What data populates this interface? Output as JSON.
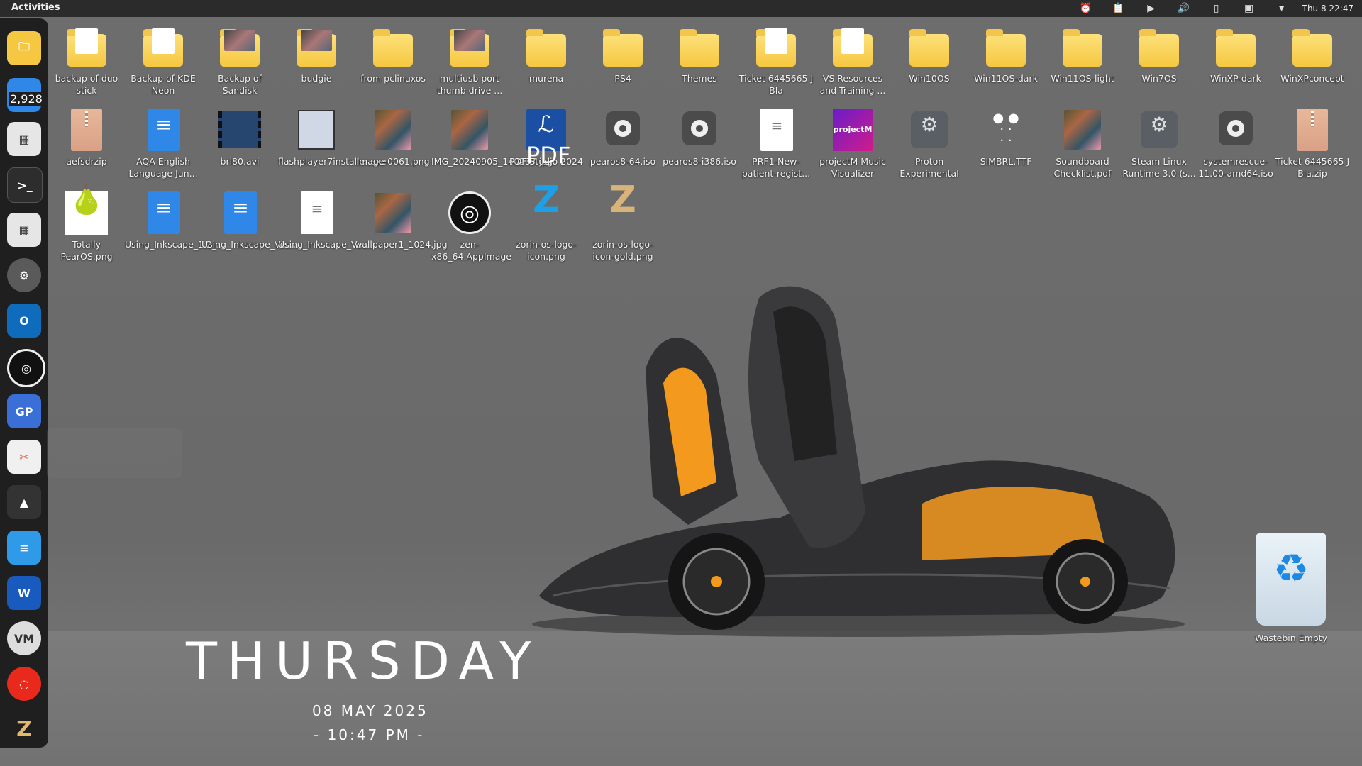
{
  "topbar": {
    "activities": "Activities",
    "clock": "Thu 8  22:47",
    "tray_icons": [
      "alarm-icon",
      "clipboard-icon",
      "play-icon",
      "volume-icon",
      "battery-icon",
      "window-icon",
      "chevron-down-icon"
    ]
  },
  "dock": {
    "mail_badge": "2,928",
    "items": [
      {
        "name": "files"
      },
      {
        "name": "mail"
      },
      {
        "name": "software"
      },
      {
        "name": "terminal"
      },
      {
        "name": "software-store"
      },
      {
        "name": "settings"
      },
      {
        "name": "outlook"
      },
      {
        "name": "zen-browser"
      },
      {
        "name": "gp-app"
      },
      {
        "name": "screenshot-tool"
      },
      {
        "name": "inkscape"
      },
      {
        "name": "writer"
      },
      {
        "name": "word"
      },
      {
        "name": "vm-app"
      },
      {
        "name": "opera-gx"
      },
      {
        "name": "zorin"
      }
    ]
  },
  "desktop": {
    "icons": [
      {
        "label": "backup of duo stick",
        "type": "folder-paper"
      },
      {
        "label": "Backup of KDE Neon",
        "type": "folder-paper"
      },
      {
        "label": "Backup of Sandisk",
        "type": "folder-photo"
      },
      {
        "label": "budgie",
        "type": "folder-photo"
      },
      {
        "label": "from pclinuxos",
        "type": "folder"
      },
      {
        "label": "multiusb port thumb drive ...",
        "type": "folder-photo"
      },
      {
        "label": "murena",
        "type": "folder"
      },
      {
        "label": "PS4",
        "type": "folder"
      },
      {
        "label": "Themes",
        "type": "folder"
      },
      {
        "label": "Ticket 6445665 J Bla",
        "type": "folder-paper"
      },
      {
        "label": "VS Resources and Training ...",
        "type": "folder-paper"
      },
      {
        "label": "Win10OS",
        "type": "folder"
      },
      {
        "label": "Win11OS-dark",
        "type": "folder"
      },
      {
        "label": "Win11OS-light",
        "type": "folder"
      },
      {
        "label": "Win7OS",
        "type": "folder"
      },
      {
        "label": "WinXP-dark",
        "type": "folder"
      },
      {
        "label": "WinXPconcept",
        "type": "folder"
      },
      {
        "label": "aefsdrzip",
        "type": "zip"
      },
      {
        "label": "AQA English Language Jun...",
        "type": "doc-blue"
      },
      {
        "label": "brl80.avi",
        "type": "video"
      },
      {
        "label": "flashplayer7installer.exe",
        "type": "exe"
      },
      {
        "label": "Image-0061.png",
        "type": "image"
      },
      {
        "label": "IMG_20240905_140237.jpg",
        "type": "image"
      },
      {
        "label": "PDF Studio 2024",
        "type": "pdf"
      },
      {
        "label": "pearos8-64.iso",
        "type": "disc"
      },
      {
        "label": "pearos8-i386.iso",
        "type": "disc"
      },
      {
        "label": "PRF1-New-patient-regist...",
        "type": "doc-white"
      },
      {
        "label": "projectM Music Visualizer",
        "type": "projectm"
      },
      {
        "label": "Proton Experimental",
        "type": "steam"
      },
      {
        "label": "SIMBRL.TTF",
        "type": "font"
      },
      {
        "label": "Soundboard Checklist.pdf",
        "type": "image"
      },
      {
        "label": "Steam Linux Runtime 3.0 (s...",
        "type": "steam"
      },
      {
        "label": "systemrescue-11.00-amd64.iso",
        "type": "disc"
      },
      {
        "label": "Ticket 6445665 J Bla.zip",
        "type": "zip"
      },
      {
        "label": "Totally PearOS.png",
        "type": "pear"
      },
      {
        "label": "Using_Inkscape_1.2_...",
        "type": "doc-blue"
      },
      {
        "label": "Using_Inkscape_Vec...",
        "type": "doc-blue"
      },
      {
        "label": "Using_Inkscape_Vec...",
        "type": "doc-white"
      },
      {
        "label": "wallpaper1_1024.jpg",
        "type": "image"
      },
      {
        "label": "zen-x86_64.AppImage",
        "type": "zen"
      },
      {
        "label": "zorin-os-logo-icon.png",
        "type": "zorin-blue"
      },
      {
        "label": "zorin-os-logo-icon-gold.png",
        "type": "zorin-gold"
      }
    ],
    "wastebin": {
      "label": "Wastebin Empty"
    }
  },
  "widget": {
    "day": "THURSDAY",
    "date": "08 MAY 2025",
    "time": "- 10:47 PM -"
  },
  "colors": {
    "folder": "#f6c741",
    "accent_orange": "#f39a1e",
    "topbar": "#2b2b2b",
    "dock": "#1f1f1f"
  }
}
